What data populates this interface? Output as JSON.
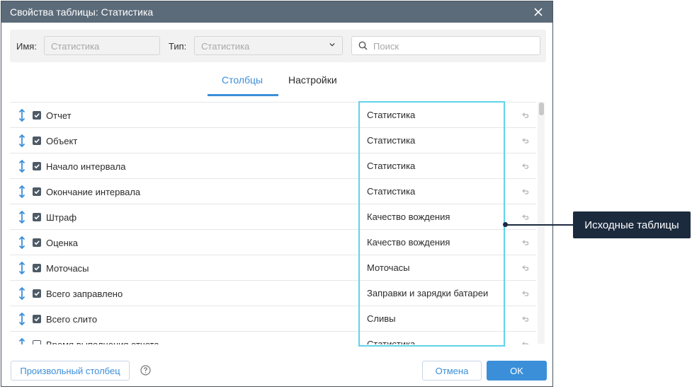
{
  "dialog": {
    "title": "Свойства таблицы: Статистика"
  },
  "filter": {
    "name_label": "Имя:",
    "name_value": "Статистика",
    "type_label": "Тип:",
    "type_value": "Статистика",
    "search_placeholder": "Поиск"
  },
  "tabs": [
    {
      "label": "Столбцы",
      "active": true
    },
    {
      "label": "Настройки",
      "active": false
    }
  ],
  "rows": [
    {
      "label": "Отчет",
      "source": "Статистика",
      "checked": true
    },
    {
      "label": "Объект",
      "source": "Статистика",
      "checked": true
    },
    {
      "label": "Начало интервала",
      "source": "Статистика",
      "checked": true
    },
    {
      "label": "Окончание интервала",
      "source": "Статистика",
      "checked": true
    },
    {
      "label": "Штраф",
      "source": "Качество вождения",
      "checked": true
    },
    {
      "label": "Оценка",
      "source": "Качество вождения",
      "checked": true
    },
    {
      "label": "Моточасы",
      "source": "Моточасы",
      "checked": true
    },
    {
      "label": "Всего заправлено",
      "source": "Заправки и зарядки батареи",
      "checked": true
    },
    {
      "label": "Всего слито",
      "source": "Сливы",
      "checked": true
    },
    {
      "label": "Время выполнения отчета",
      "source": "Статистика",
      "checked": false
    }
  ],
  "footer": {
    "custom_column": "Произвольный столбец",
    "cancel": "Отмена",
    "ok": "OK"
  },
  "callout": {
    "text": "Исходные таблицы"
  },
  "colors": {
    "accent": "#3b8fd9",
    "highlight": "#5fd4e6",
    "titlebar": "#5c6b7a",
    "callout": "#1c2a3e"
  }
}
